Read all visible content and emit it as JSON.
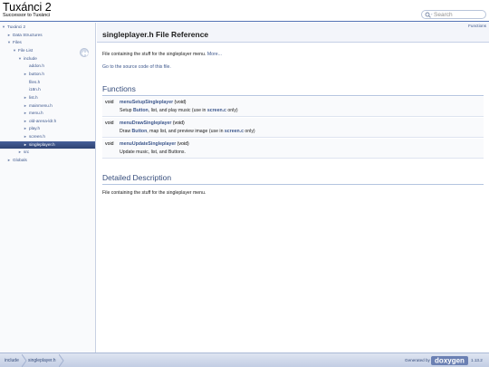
{
  "project": {
    "name": "Tuxánci 2",
    "brief": "Successor to Tuxánci"
  },
  "search": {
    "placeholder": "Search"
  },
  "nav": {
    "items": [
      {
        "label": "Tuxánci 2",
        "arrow": "▼"
      },
      {
        "label": "Data Structures",
        "arrow": "►"
      },
      {
        "label": "Files",
        "arrow": "▼"
      },
      {
        "label": "File List",
        "arrow": "▼"
      },
      {
        "label": "include",
        "arrow": "▼"
      },
      {
        "label": "addon.h",
        "arrow": ""
      },
      {
        "label": "button.h",
        "arrow": "►"
      },
      {
        "label": "files.h",
        "arrow": ""
      },
      {
        "label": "i18n.h",
        "arrow": ""
      },
      {
        "label": "list.h",
        "arrow": "►"
      },
      {
        "label": "mainmenu.h",
        "arrow": "►"
      },
      {
        "label": "menu.h",
        "arrow": "►"
      },
      {
        "label": "old-arena-ldr.h",
        "arrow": "►"
      },
      {
        "label": "play.h",
        "arrow": "►"
      },
      {
        "label": "screen.h",
        "arrow": "►"
      },
      {
        "label": "singleplayer.h",
        "arrow": "►",
        "selected": true
      },
      {
        "label": "src",
        "arrow": "►"
      },
      {
        "label": "Globals",
        "arrow": "►"
      }
    ]
  },
  "header": {
    "summary_link": "Functions",
    "title": "singleplayer.h File Reference"
  },
  "content": {
    "brief": "File containing the stuff for the singleplayer menu.",
    "more": "More...",
    "source_link": "Go to the source code of this file.",
    "functions_heading": "Functions",
    "functions": [
      {
        "type": "void",
        "name": "menuSetupSingleplayer",
        "args": " (void)",
        "desc_pre": "Setup ",
        "desc_b1": "Button",
        "desc_mid": ", list, and play music (use in ",
        "desc_b2": "screen.c",
        "desc_post": " only)"
      },
      {
        "type": "void",
        "name": "menuDrawSingleplayer",
        "args": " (void)",
        "desc_pre": "Draw ",
        "desc_b1": "Button",
        "desc_mid": ", map list, and preview image (use in ",
        "desc_b2": "screen.c",
        "desc_post": " only)"
      },
      {
        "type": "void",
        "name": "menuUpdateSingleplayer",
        "args": " (void)",
        "desc_pre": "Update music, list, and Buttons.",
        "desc_b1": "",
        "desc_mid": "",
        "desc_b2": "",
        "desc_post": ""
      }
    ],
    "detailed_heading": "Detailed Description",
    "detailed_text": "File containing the stuff for the singleplayer menu."
  },
  "footer": {
    "crumbs": [
      "include",
      "singleplayer.h"
    ],
    "generated_by": "Generated by",
    "logo_text": "doxygen",
    "version": "1.13.2"
  },
  "colors": {
    "link": "#3d578c",
    "selected_nav": "#33456e",
    "heading": "#354c7b"
  }
}
